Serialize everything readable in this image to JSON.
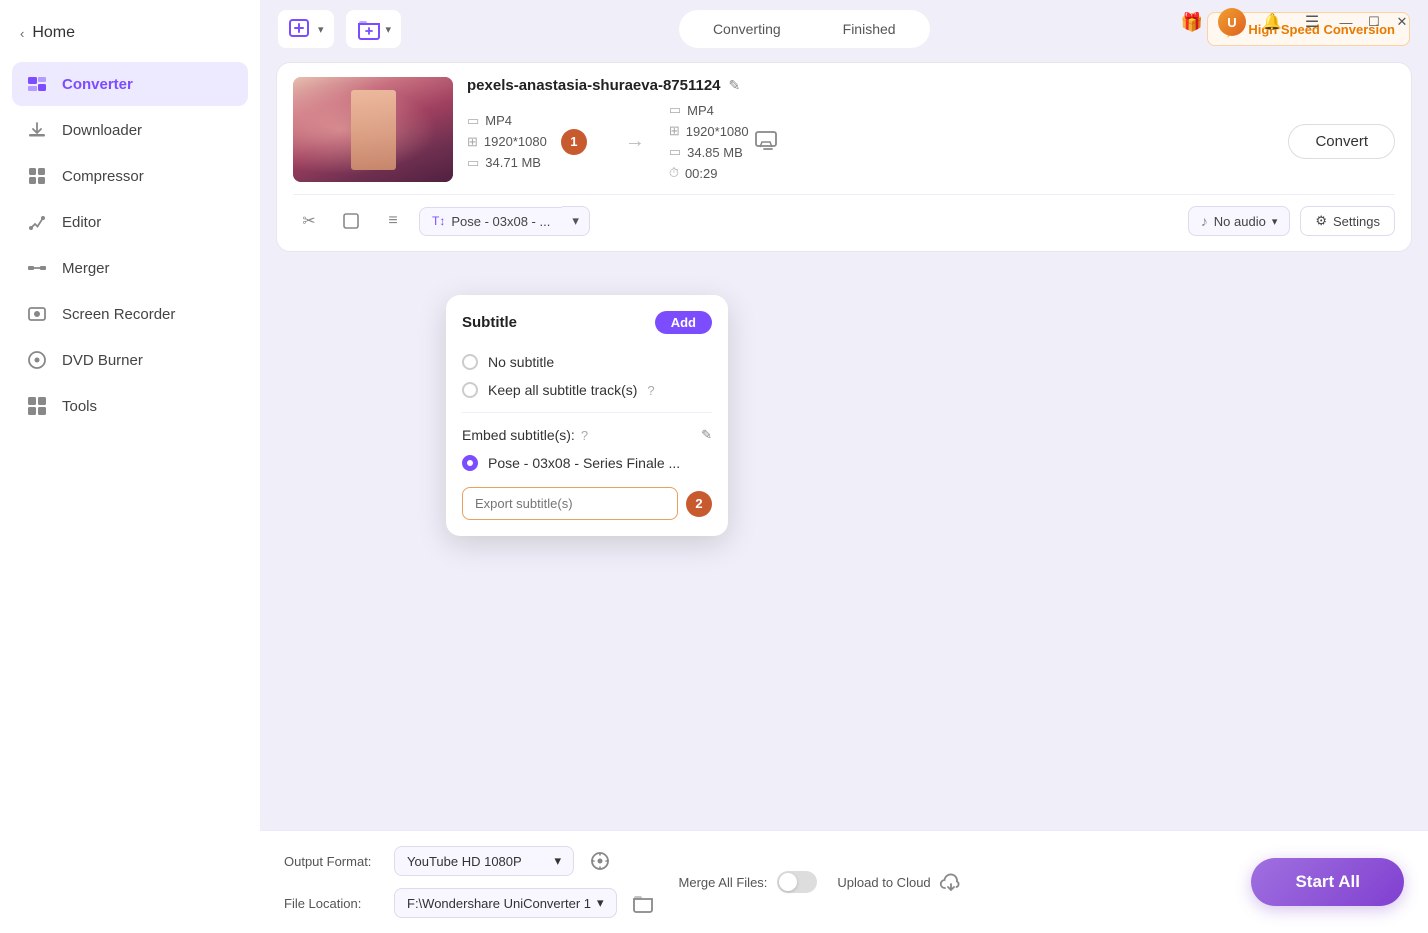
{
  "titlebar": {
    "gift_icon": "🎁",
    "user_initial": "U",
    "bell_icon": "🔔",
    "menu_icon": "☰",
    "minimize": "—",
    "maximize": "☐",
    "close": "✕"
  },
  "sidebar": {
    "home_label": "Home",
    "items": [
      {
        "id": "converter",
        "label": "Converter",
        "icon": "⬛",
        "active": true
      },
      {
        "id": "downloader",
        "label": "Downloader",
        "icon": "⬇"
      },
      {
        "id": "compressor",
        "label": "Compressor",
        "icon": "📦"
      },
      {
        "id": "editor",
        "label": "Editor",
        "icon": "✂"
      },
      {
        "id": "merger",
        "label": "Merger",
        "icon": "🔗"
      },
      {
        "id": "screen-recorder",
        "label": "Screen Recorder",
        "icon": "📷"
      },
      {
        "id": "dvd-burner",
        "label": "DVD Burner",
        "icon": "💿"
      },
      {
        "id": "tools",
        "label": "Tools",
        "icon": "⚙"
      }
    ]
  },
  "topbar": {
    "add_file_label": "Add File",
    "add_folder_label": "Add Folder",
    "tab_converting": "Converting",
    "tab_finished": "Finished",
    "high_speed_label": "High Speed Conversion"
  },
  "file_card": {
    "filename": "pexels-anastasia-shuraeva-8751124",
    "source": {
      "format": "MP4",
      "resolution": "1920*1080",
      "size": "34.71 MB",
      "badge": "1"
    },
    "target": {
      "format": "MP4",
      "resolution": "1920*1080",
      "size": "34.85 MB",
      "duration": "00:29"
    },
    "convert_label": "Convert",
    "tools": {
      "cut_icon": "✂",
      "crop_icon": "▭",
      "effects_icon": "≡"
    },
    "subtitle_track": "Pose - 03x08 - ...",
    "audio_track": "No audio",
    "settings_label": "Settings"
  },
  "dropdown": {
    "title": "Subtitle",
    "add_label": "Add",
    "options": [
      {
        "id": "no-subtitle",
        "label": "No subtitle",
        "selected": false
      },
      {
        "id": "keep-all",
        "label": "Keep all subtitle track(s)",
        "selected": false
      }
    ],
    "embed_label": "Embed subtitle(s):",
    "embed_item": "Pose - 03x08 - Series Finale ...",
    "export_placeholder": "Export subtitle(s)",
    "step1_badge": "1",
    "step2_badge": "2"
  },
  "bottom_bar": {
    "output_format_label": "Output Format:",
    "output_format_value": "YouTube HD 1080P",
    "file_location_label": "File Location:",
    "file_location_value": "F:\\Wondershare UniConverter 1",
    "merge_label": "Merge All Files:",
    "upload_cloud_label": "Upload to Cloud",
    "start_all_label": "Start All"
  }
}
